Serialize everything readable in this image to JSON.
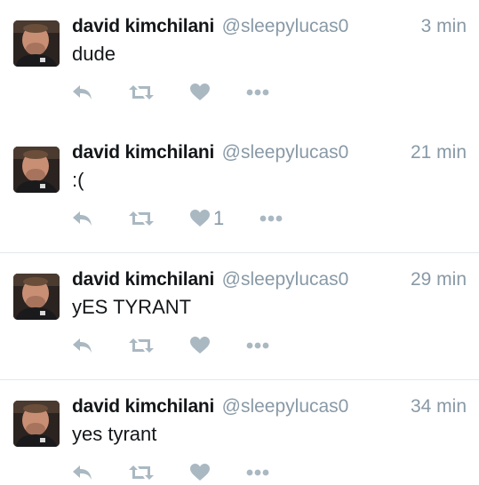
{
  "tweets": [
    {
      "name": "david kimchilani",
      "handle": "@sleepylucas0",
      "time": "3 min",
      "text": "dude",
      "like_count": ""
    },
    {
      "name": "david kimchilani",
      "handle": "@sleepylucas0",
      "time": "21 min",
      "text": ":(",
      "like_count": "1"
    },
    {
      "name": "david kimchilani",
      "handle": "@sleepylucas0",
      "time": "29 min",
      "text": "yES TYRANT",
      "like_count": ""
    },
    {
      "name": "david kimchilani",
      "handle": "@sleepylucas0",
      "time": "34 min",
      "text": "yes tyrant",
      "like_count": ""
    }
  ],
  "icons": {
    "reply": "reply-icon",
    "retweet": "retweet-icon",
    "like": "heart-icon",
    "more": "more-icon"
  },
  "colors": {
    "action_icon": "#aab8c2",
    "muted_text": "#8899a6",
    "primary_text": "#14171a",
    "divider": "#e1e8ed"
  }
}
